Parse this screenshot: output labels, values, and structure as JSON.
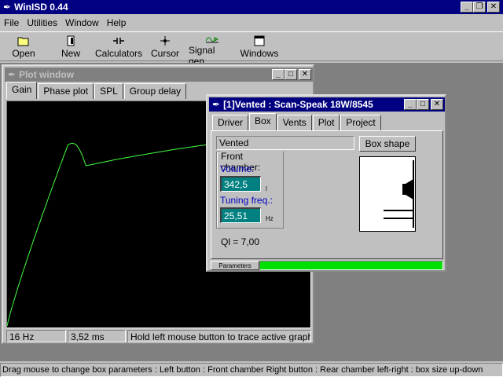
{
  "app": {
    "title": "WinISD 0.44"
  },
  "menu": {
    "items": [
      "File",
      "Utilities",
      "Window",
      "Help"
    ]
  },
  "toolbar": {
    "buttons": [
      {
        "label": "Open",
        "icon": "folder-icon"
      },
      {
        "label": "New",
        "icon": "new-document-icon"
      },
      {
        "label": "Calculators",
        "icon": "calculator-icon"
      },
      {
        "label": "Cursor",
        "icon": "crosshair-icon"
      },
      {
        "label": "Signal gen.",
        "icon": "signal-generator-icon"
      },
      {
        "label": "Windows",
        "icon": "window-icon"
      }
    ]
  },
  "plot_window": {
    "title": "Plot window",
    "tabs": [
      "Gain",
      "Phase plot",
      "SPL",
      "Group delay"
    ],
    "active_tab": "Gain",
    "status": {
      "freq": "16 Hz",
      "time": "3,52 ms",
      "hint": "Hold left mouse button to trace active graph"
    },
    "curve_color": "#40ff40"
  },
  "box_window": {
    "title": "[1]Vented : Scan-Speak 18W/8545",
    "tabs": [
      "Driver",
      "Box",
      "Vents",
      "Plot",
      "Project"
    ],
    "active_tab": "Box",
    "box_type": "Vented",
    "box_shape_label": "Box shape",
    "front_chamber": {
      "legend": "Front chamber:",
      "volume_label": "Volume:",
      "volume_value": "342,5",
      "volume_unit": "l",
      "tuning_label": "Tuning freq.:",
      "tuning_value": "25,51",
      "tuning_unit": "Hz"
    },
    "ql": "Ql = 7,00",
    "params_label": "Parameters",
    "params_progress": 1.0,
    "progress_color": "#00e000"
  },
  "status_bar": {
    "text": "Drag mouse to change box parameters :  Left button : Front chamber  Right button : Rear chamber  left-right : box size  up-down"
  }
}
